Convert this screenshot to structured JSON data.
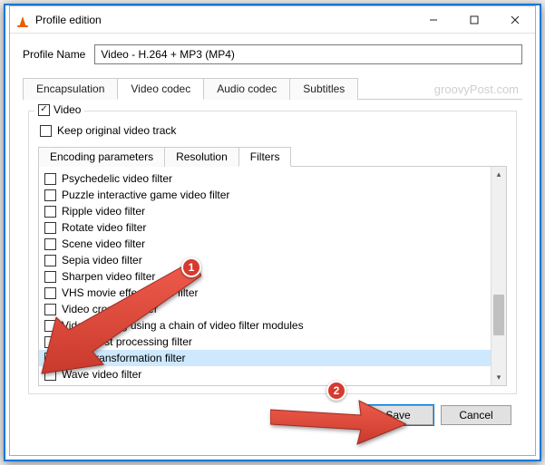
{
  "window": {
    "title": "Profile edition"
  },
  "profile": {
    "label": "Profile Name",
    "value": "Video - H.264 + MP3 (MP4)"
  },
  "watermark": "groovyPost.com",
  "outerTabs": {
    "t0": "Encapsulation",
    "t1": "Video codec",
    "t2": "Audio codec",
    "t3": "Subtitles"
  },
  "videoCheck": "Video",
  "keepOriginal": "Keep original video track",
  "innerTabs": {
    "i0": "Encoding parameters",
    "i1": "Resolution",
    "i2": "Filters"
  },
  "filters": {
    "f0": "Psychedelic video filter",
    "f1": "Puzzle interactive game video filter",
    "f2": "Ripple video filter",
    "f3": "Rotate video filter",
    "f4": "Scene video filter",
    "f5": "Sepia video filter",
    "f6": "Sharpen video filter",
    "f7": "VHS movie effect video filter",
    "f8": "Video cropping filter",
    "f9": "Video filtering using a chain of video filter modules",
    "f10": "Video post processing filter",
    "f11": "Video transformation filter",
    "f12": "Wave video filter"
  },
  "buttons": {
    "save": "Save",
    "cancel": "Cancel"
  },
  "badges": {
    "b1": "1",
    "b2": "2"
  }
}
